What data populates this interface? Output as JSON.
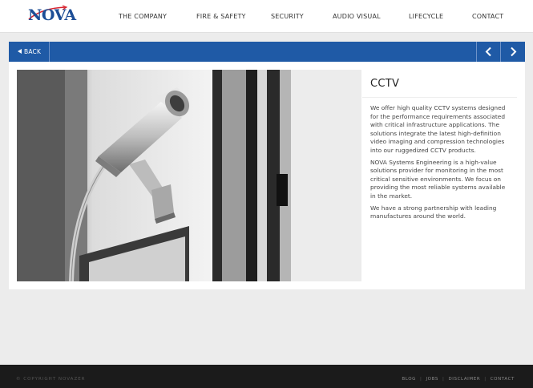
{
  "header": {
    "logo_text": "NOVA",
    "nav": [
      {
        "label": "THE COMPANY"
      },
      {
        "label": "FIRE & SAFETY"
      },
      {
        "label": "SECURITY"
      },
      {
        "label": "AUDIO VISUAL"
      },
      {
        "label": "LIFECYCLE"
      },
      {
        "label": "CONTACT"
      }
    ]
  },
  "toolbar": {
    "back_label": "BACK",
    "prev_icon": "chevron-left-icon",
    "next_icon": "chevron-right-icon"
  },
  "content": {
    "title": "CCTV",
    "paragraphs": [
      "We offer high quality CCTV systems designed for the performance requirements associated with critical infrastructure applications. The solutions integrate the latest high-definition video imaging and compression technologies into our ruggedized CCTV products.",
      "NOVA Systems Engineering is a high-value solutions provider for monitoring in the most critical sensitive environments. We focus on providing the most reliable systems available in the market.",
      "We have a strong partnership with leading manufactures around the world."
    ]
  },
  "footer": {
    "copyright": "© COPYRIGHT NOVAZER",
    "links": [
      {
        "label": "BLOG"
      },
      {
        "label": "JOBS"
      },
      {
        "label": "DISCLAIMER"
      },
      {
        "label": "CONTACT"
      }
    ]
  },
  "colors": {
    "brand_blue": "#1f5aa6",
    "logo_blue": "#1d4e96",
    "logo_red": "#d9232e",
    "footer_bg": "#1b1b1b"
  }
}
